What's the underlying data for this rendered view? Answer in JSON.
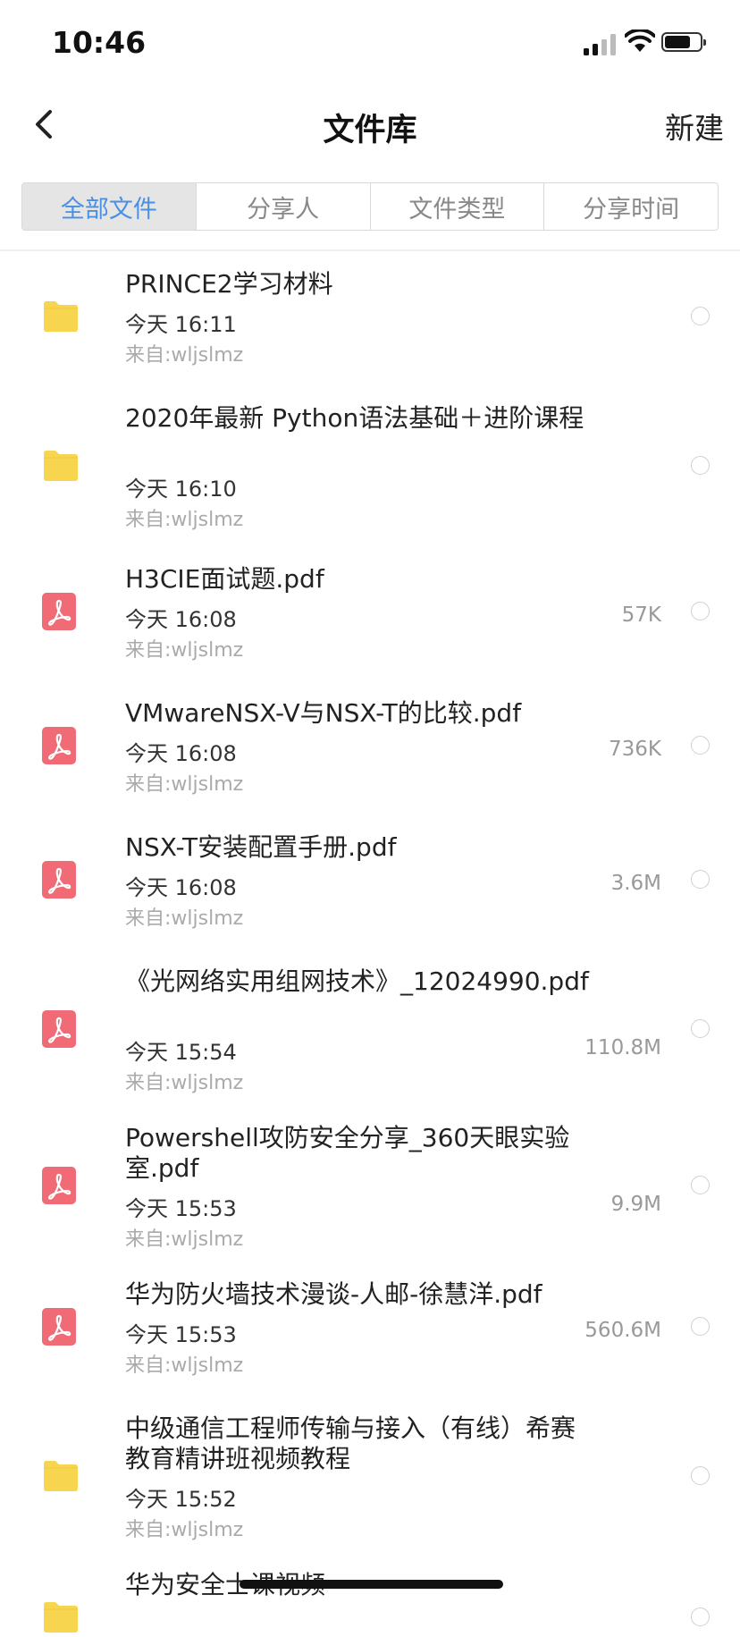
{
  "status_bar": {
    "time": "10:46"
  },
  "nav": {
    "title": "文件库",
    "new_label": "新建",
    "back_icon": "chevron-left-icon"
  },
  "tabs": [
    {
      "label": "全部文件",
      "active": true
    },
    {
      "label": "分享人",
      "active": false
    },
    {
      "label": "文件类型",
      "active": false
    },
    {
      "label": "分享时间",
      "active": false
    }
  ],
  "colors": {
    "accent": "#4a90e2",
    "folder": "#f8d54e",
    "pdf": "#f06b75"
  },
  "files": [
    {
      "type": "folder",
      "name": "PRINCE2学习材料",
      "date": "今天 16:11",
      "source": "来自:wljslmz",
      "size": ""
    },
    {
      "type": "folder",
      "name": "2020年最新 Python语法基础＋进阶课程",
      "date": "今天 16:10",
      "source": "来自:wljslmz",
      "size": ""
    },
    {
      "type": "pdf",
      "name": "H3CIE面试题.pdf",
      "date": "今天 16:08",
      "source": "来自:wljslmz",
      "size": "57K"
    },
    {
      "type": "pdf",
      "name": "VMwareNSX-V与NSX-T的比较.pdf",
      "date": "今天 16:08",
      "source": "来自:wljslmz",
      "size": "736K"
    },
    {
      "type": "pdf",
      "name": "NSX-T安装配置手册.pdf",
      "date": "今天 16:08",
      "source": "来自:wljslmz",
      "size": "3.6M"
    },
    {
      "type": "pdf",
      "name": "《光网络实用组网技术》_12024990.pdf",
      "date": "今天 15:54",
      "source": "来自:wljslmz",
      "size": "110.8M"
    },
    {
      "type": "pdf",
      "name": "Powershell攻防安全分享_360天眼实验室.pdf",
      "date": "今天 15:53",
      "source": "来自:wljslmz",
      "size": "9.9M"
    },
    {
      "type": "pdf",
      "name": "华为防火墙技术漫谈-人邮-徐慧洋.pdf",
      "date": "今天 15:53",
      "source": "来自:wljslmz",
      "size": "560.6M"
    },
    {
      "type": "folder",
      "name": "中级通信工程师传输与接入（有线）希赛教育精讲班视频教程",
      "date": "今天 15:52",
      "source": "来自:wljslmz",
      "size": ""
    },
    {
      "type": "folder",
      "name": "华为安全士课视频",
      "date": "",
      "source": "",
      "size": ""
    }
  ]
}
